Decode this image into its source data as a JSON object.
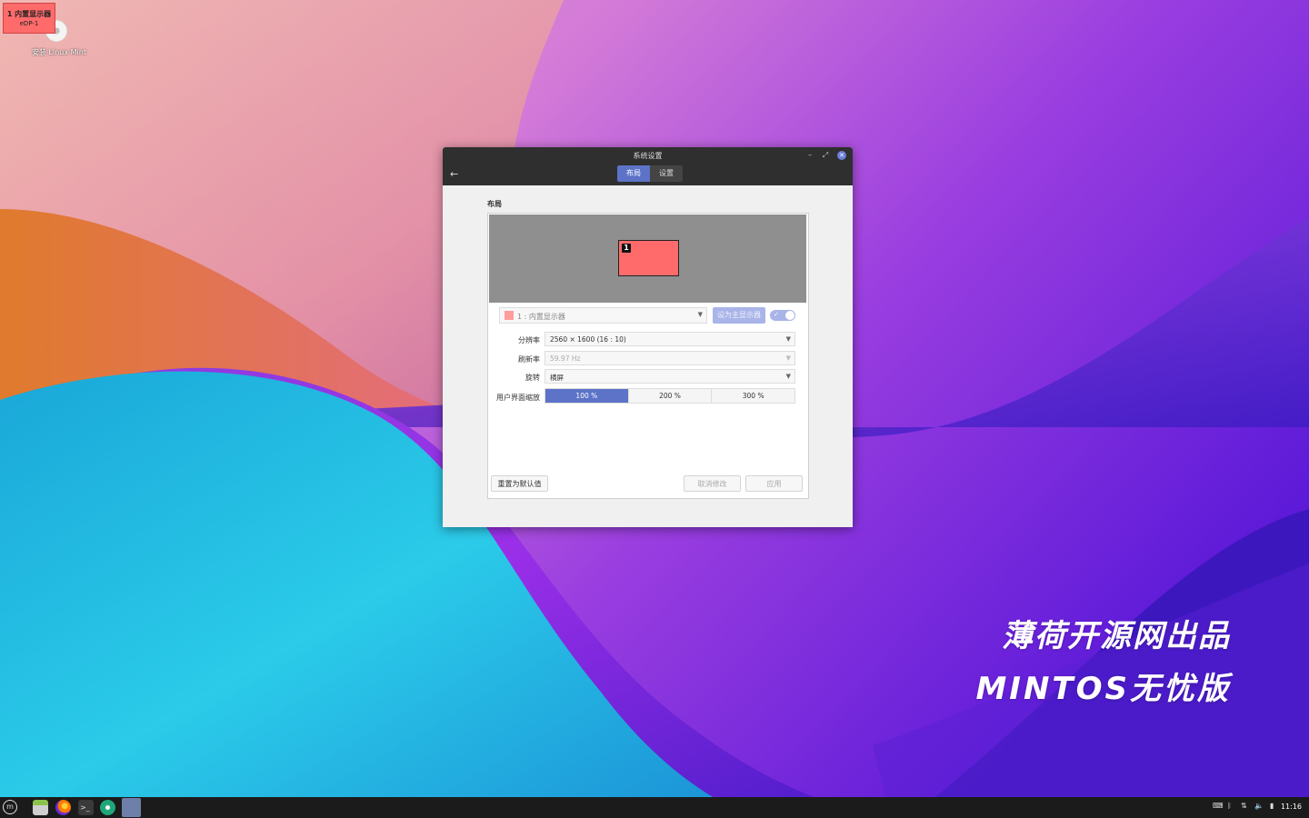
{
  "desktop": {
    "osd_title": "1  内置显示器",
    "osd_output": "eDP-1",
    "icon_label": "安装 Linux Mint",
    "watermark_line1": "薄荷开源网出品",
    "watermark_line2": "MINTOS无忧版"
  },
  "window": {
    "title": "系统设置",
    "minimize": "–",
    "maximize": "⤢",
    "close": "✕",
    "back_icon": "←",
    "tabs": [
      {
        "label": "布局",
        "active": true
      },
      {
        "label": "设置",
        "active": false
      }
    ]
  },
  "layout_section": {
    "title": "布局",
    "monitor_badge": "1",
    "monitor_color": "#ff6b6b"
  },
  "monitor_selector": {
    "value": "1 : 内置显示器",
    "set_primary_label": "设为主显示器",
    "enabled": true
  },
  "settings": {
    "resolution_label": "分辨率",
    "resolution_value": "2560 × 1600 (16 : 10)",
    "refresh_label": "刷新率",
    "refresh_value": "59.97 Hz",
    "rotation_label": "旋转",
    "rotation_value": "横屏",
    "scale_label": "用户界面缩放",
    "scale_options": [
      "100 %",
      "200 %",
      "300 %"
    ],
    "scale_selected": "100 %"
  },
  "buttons": {
    "reset": "重置为默认值",
    "cancel": "取消修改",
    "apply": "应用"
  },
  "taskbar": {
    "clock": "11:16",
    "accent": "#5c73c8"
  }
}
